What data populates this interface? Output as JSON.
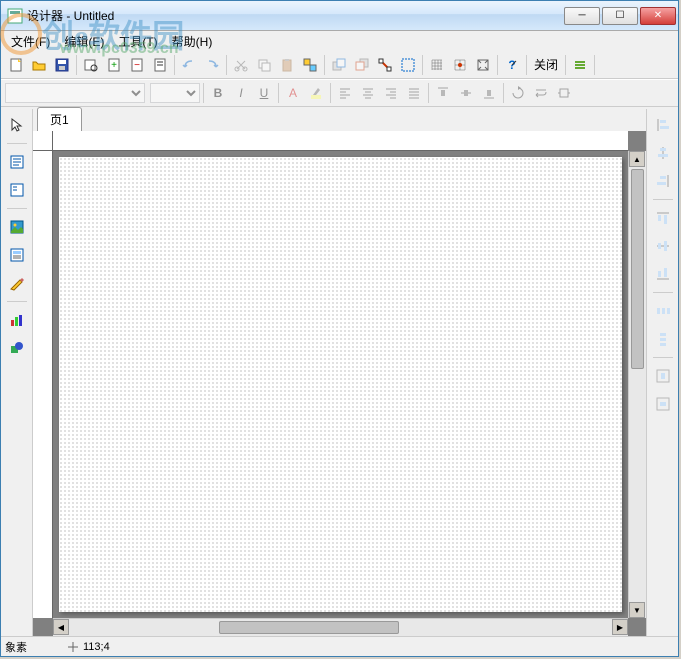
{
  "window": {
    "title": "设计器 - Untitled"
  },
  "menu": {
    "file": "文件(F)",
    "edit": "编辑(E)",
    "tools": "工具(T)",
    "help": "帮助(H)"
  },
  "toolbar": {
    "close_label": "关闭",
    "bold": "B",
    "italic": "I",
    "underline": "U",
    "font_a": "A"
  },
  "tabs": {
    "page1": "页1"
  },
  "status": {
    "element_label": "象素",
    "coords": "113;4"
  },
  "watermark": {
    "brand": "创e软件园",
    "url": "www.pc0359.cn"
  }
}
